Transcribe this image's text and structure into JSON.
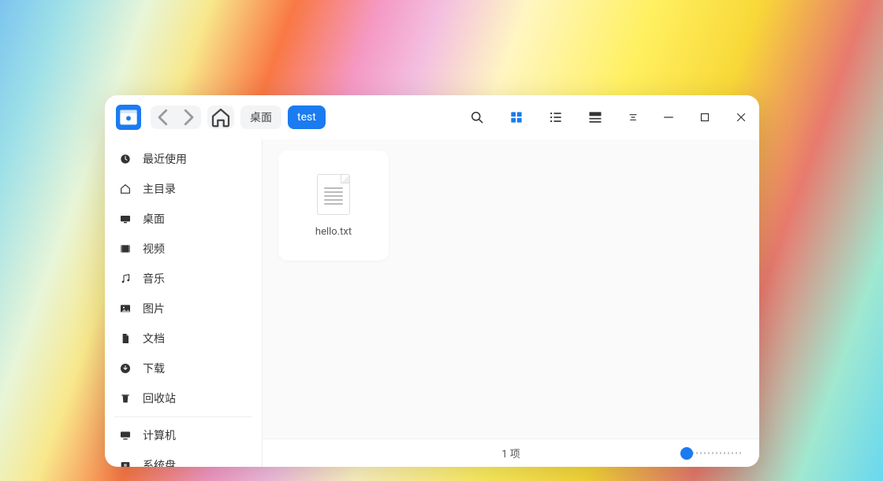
{
  "breadcrumb": {
    "parent": "桌面",
    "current": "test"
  },
  "sidebar": {
    "items": [
      {
        "icon": "clock",
        "label": "最近使用"
      },
      {
        "icon": "home",
        "label": "主目录"
      },
      {
        "icon": "desktop",
        "label": "桌面"
      },
      {
        "icon": "video",
        "label": "视频"
      },
      {
        "icon": "music",
        "label": "音乐"
      },
      {
        "icon": "image",
        "label": "图片"
      },
      {
        "icon": "doc",
        "label": "文档"
      },
      {
        "icon": "download",
        "label": "下载"
      },
      {
        "icon": "trash",
        "label": "回收站"
      }
    ],
    "items2": [
      {
        "icon": "computer",
        "label": "计算机"
      },
      {
        "icon": "disk",
        "label": "系统盘"
      }
    ]
  },
  "files": [
    {
      "name": "hello.txt",
      "type": "text"
    }
  ],
  "status": {
    "count_text": "1 项"
  }
}
